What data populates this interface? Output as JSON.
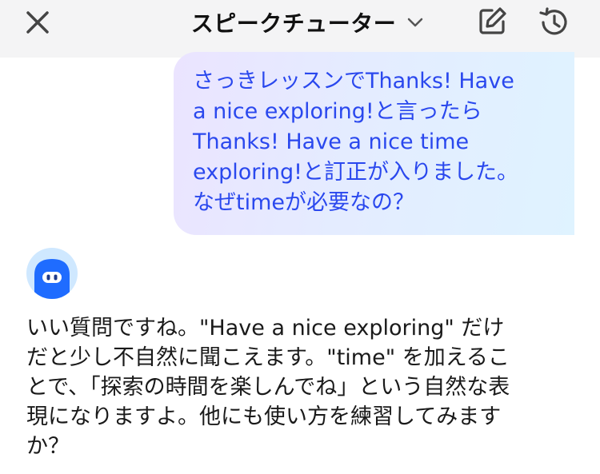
{
  "header": {
    "title": "スピークチューター",
    "close_icon": "close-icon",
    "chevron_icon": "chevron-down-icon",
    "edit_icon": "edit-icon",
    "history_icon": "history-icon"
  },
  "chat": {
    "user_message": "さっきレッスンでThanks! Have\na nice exploring!と言ったら\nThanks! Have a nice time\nexploring!と訂正が入りました。\nなぜtimeが必要なの？",
    "assistant_message": "いい質問ですね。\"Have a nice exploring\" だけ\nだと少し不自然に聞こえます。\"time\" を加えるこ\nとで、「探索の時間を楽しんでね」という自然な表\n現になりますよ。他にも使い方を練習してみます\nか？"
  },
  "colors": {
    "user_text": "#2a48ee",
    "header_bg": "#f4f4f5",
    "avatar_blue": "#1f6cff"
  }
}
